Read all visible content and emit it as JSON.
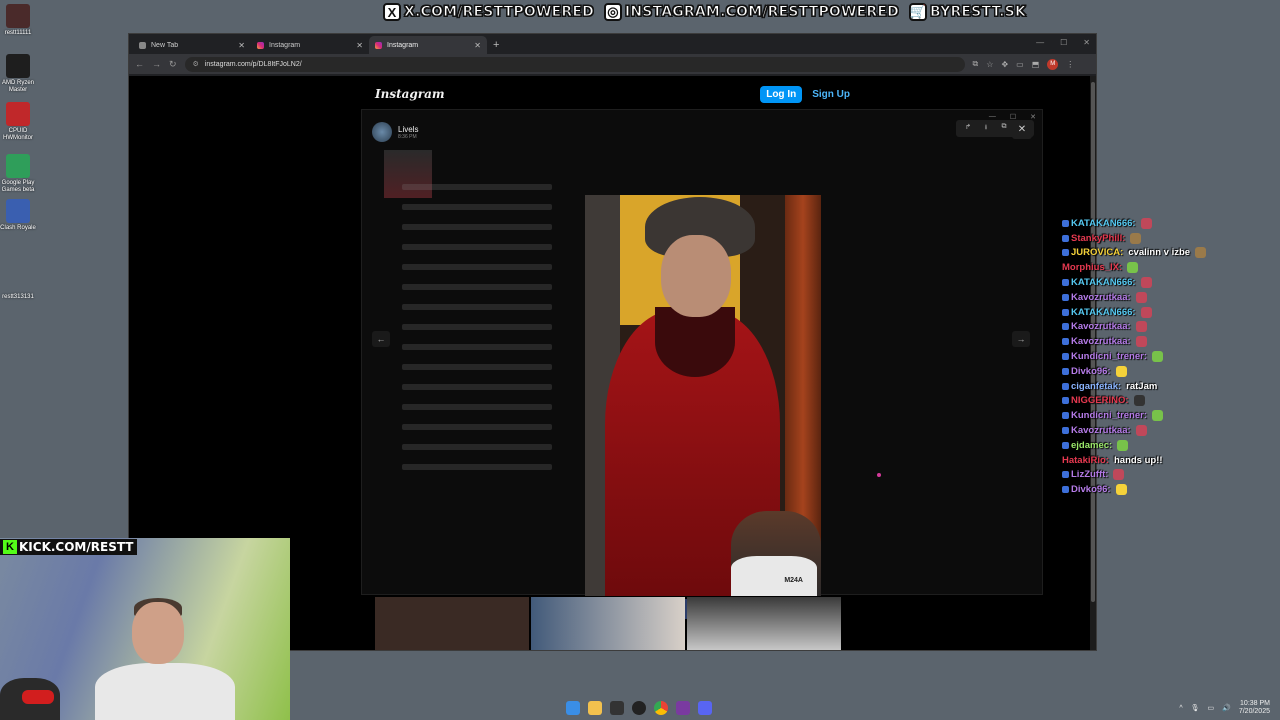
{
  "banner": {
    "items": [
      {
        "icon": "x-logo-icon",
        "glyph": "X",
        "text": "X.COM/RESTTPOWERED"
      },
      {
        "icon": "instagram-icon",
        "glyph": "◎",
        "text": "INSTAGRAM.COM/RESTTPOWERED"
      },
      {
        "icon": "cart-icon",
        "glyph": "🛒",
        "text": "BYRESTT.SK"
      }
    ]
  },
  "desktop": {
    "icons": [
      {
        "label": "restt11111",
        "color": "#4a2a2a"
      },
      {
        "label": "AMD Ryzen Master",
        "color": "#1e1e1e"
      },
      {
        "label": "CPUID HWMonitor",
        "color": "#c0282a"
      },
      {
        "label": "Google Play Games beta",
        "color": "#2f9e5a"
      },
      {
        "label": "Clash Royale",
        "color": "#3a5fb0"
      },
      {
        "label": "restt313131",
        "color": "#5b646d"
      }
    ]
  },
  "browser": {
    "tabs": [
      {
        "label": "New Tab",
        "active": false
      },
      {
        "label": "Instagram",
        "active": false
      },
      {
        "label": "Instagram",
        "active": true
      }
    ],
    "new_tab_glyph": "+",
    "url": "instagram.com/p/DL8ItFJoLN2/",
    "profile_initial": "M"
  },
  "instagram": {
    "logo": "Instagram",
    "login_label": "Log In",
    "signup_label": "Sign Up",
    "poster_name": "Livels",
    "poster_time": "8:36 PM",
    "video_overlay_text": "M24A"
  },
  "chat": {
    "messages": [
      {
        "user": "KATAKAN666:",
        "color": "#55c8f0",
        "badge": true,
        "text": "",
        "emote": "red"
      },
      {
        "user": "StankyPhill:",
        "color": "#e63950",
        "badge": true,
        "text": "",
        "emote": "face"
      },
      {
        "user": "JUROVICA:",
        "color": "#f5d23a",
        "badge": true,
        "text": "cvalinn v izbe",
        "emote": "face"
      },
      {
        "user": "Morphius_IX:",
        "color": "#e63950",
        "badge": false,
        "text": "",
        "emote": "green"
      },
      {
        "user": "KATAKAN666:",
        "color": "#55c8f0",
        "badge": true,
        "text": "",
        "emote": "red"
      },
      {
        "user": "Kavozrutkaa:",
        "color": "#b57be8",
        "badge": true,
        "text": "",
        "emote": "red"
      },
      {
        "user": "KATAKAN666:",
        "color": "#55c8f0",
        "badge": true,
        "text": "",
        "emote": "red"
      },
      {
        "user": "Kavozrutkaa:",
        "color": "#b57be8",
        "badge": true,
        "text": "",
        "emote": "red"
      },
      {
        "user": "Kavozrutkaa:",
        "color": "#b57be8",
        "badge": true,
        "text": "",
        "emote": "red"
      },
      {
        "user": "Kundicni_trener:",
        "color": "#b57be8",
        "badge": true,
        "text": "",
        "emote": "green"
      },
      {
        "user": "Divko96:",
        "color": "#b57be8",
        "badge": true,
        "text": "",
        "emote": "yellow"
      },
      {
        "user": "ciganfetak:",
        "color": "#8ab4ff",
        "badge": true,
        "text": "ratJam",
        "emote": ""
      },
      {
        "user": "NIGGERINO:",
        "color": "#e63950",
        "badge": true,
        "text": "",
        "emote": "dark"
      },
      {
        "user": "Kundicni_trener:",
        "color": "#b57be8",
        "badge": true,
        "text": "",
        "emote": "green"
      },
      {
        "user": "Kavozrutkaa:",
        "color": "#b57be8",
        "badge": true,
        "text": "",
        "emote": "red"
      },
      {
        "user": "ejdamec:",
        "color": "#9be86a",
        "badge": true,
        "text": "",
        "emote": "green"
      },
      {
        "user": "HatakiRio:",
        "color": "#e63950",
        "badge": false,
        "text": "hands up!!",
        "emote": ""
      },
      {
        "user": "LizZufft:",
        "color": "#b57be8",
        "badge": true,
        "text": "",
        "emote": "red"
      },
      {
        "user": "Divko96:",
        "color": "#b57be8",
        "badge": true,
        "text": "",
        "emote": "yellow"
      }
    ]
  },
  "stream": {
    "kick_label": "KICK.COM/RESTT"
  },
  "taskbar": {
    "time": "10:38 PM",
    "date": "7/20/2025"
  }
}
